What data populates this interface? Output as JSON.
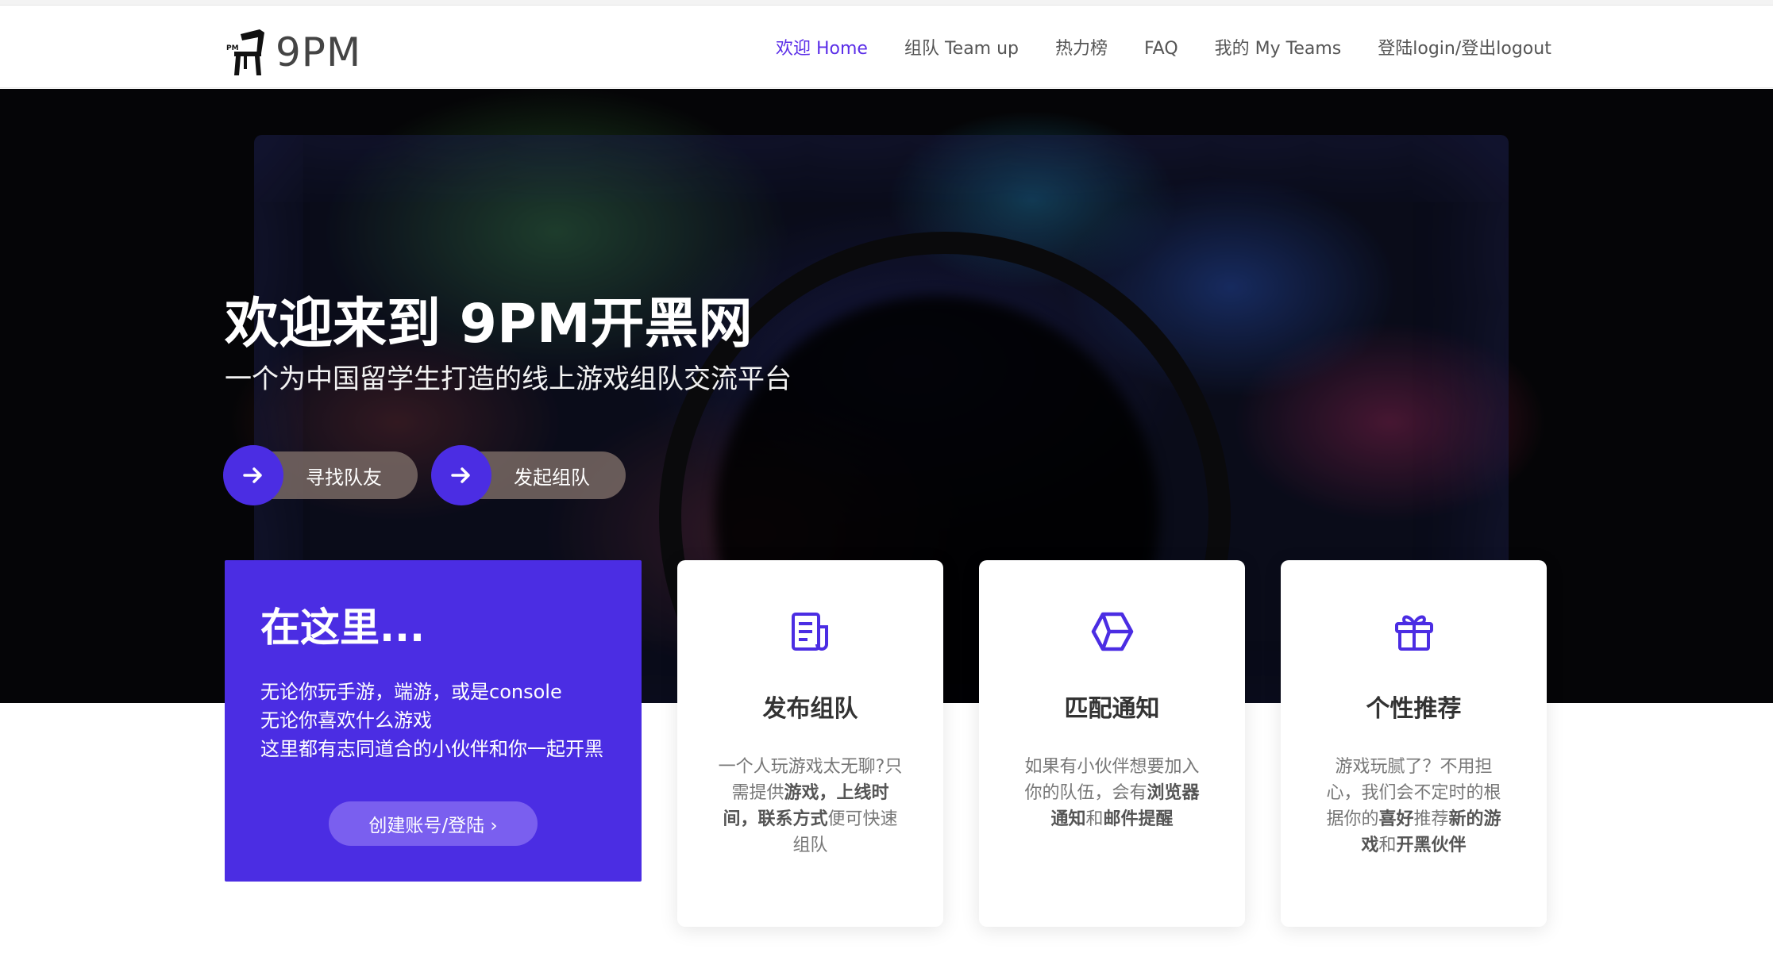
{
  "header": {
    "logo_text": "9PM",
    "nav": [
      {
        "label": "欢迎 Home",
        "active": true
      },
      {
        "label": "组队 Team up",
        "active": false
      },
      {
        "label": "热力榜",
        "active": false
      },
      {
        "label": "FAQ",
        "active": false
      },
      {
        "label": "我的 My Teams",
        "active": false
      },
      {
        "label": "登陆login/登出logout",
        "active": false
      }
    ]
  },
  "hero": {
    "title": "欢迎来到 9PM开黑网",
    "subtitle": "一个为中国留学生打造的线上游戏组队交流平台",
    "buttons": [
      {
        "label": "寻找队友",
        "icon": "arrow-right-icon"
      },
      {
        "label": "发起组队",
        "icon": "arrow-right-icon"
      }
    ]
  },
  "intro_card": {
    "title": "在这里...",
    "lines": [
      "无论你玩手游，端游，或是console",
      "无论你喜欢什么游戏",
      "这里都有志同道合的小伙伴和你一起开黑"
    ],
    "button_label": "创建账号/登陆 ›"
  },
  "features": [
    {
      "icon": "document-icon",
      "title": "发布组队",
      "desc_parts": [
        {
          "text": "一个人玩游戏太无聊?只需提供",
          "bold": false
        },
        {
          "text": "游戏，上线时间，联系方式",
          "bold": true
        },
        {
          "text": "便可快速组队",
          "bold": false
        }
      ]
    },
    {
      "icon": "hexagon-icon",
      "title": "匹配通知",
      "desc_parts": [
        {
          "text": "如果有小伙伴想要加入你的队伍，会有",
          "bold": false
        },
        {
          "text": "浏览器通知",
          "bold": true
        },
        {
          "text": "和",
          "bold": false
        },
        {
          "text": "邮件提醒",
          "bold": true
        }
      ]
    },
    {
      "icon": "gift-icon",
      "title": "个性推荐",
      "desc_parts": [
        {
          "text": "游戏玩腻了？不用担心，我们会不定时的根据你的",
          "bold": false
        },
        {
          "text": "喜好",
          "bold": true
        },
        {
          "text": "推荐",
          "bold": false
        },
        {
          "text": "新的游戏",
          "bold": true
        },
        {
          "text": "和",
          "bold": false
        },
        {
          "text": "开黑伙伴",
          "bold": true
        }
      ]
    }
  ],
  "colors": {
    "accent": "#4b2de3",
    "nav_active": "#5b2ee8"
  }
}
